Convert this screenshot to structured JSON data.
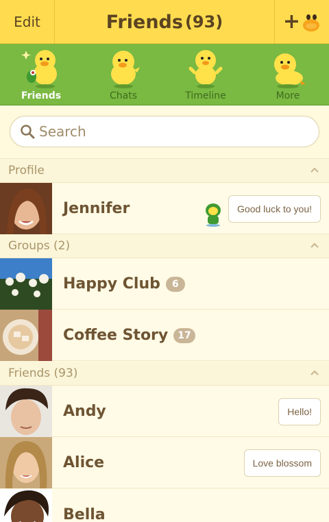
{
  "header": {
    "edit_label": "Edit",
    "title": "Friends",
    "count": "(93)",
    "add_icon": "add-friend-icon"
  },
  "tabs": [
    {
      "label": "Friends",
      "active": true
    },
    {
      "label": "Chats",
      "active": false
    },
    {
      "label": "Timeline",
      "active": false
    },
    {
      "label": "More",
      "active": false
    }
  ],
  "search": {
    "placeholder": "Search"
  },
  "sections": {
    "profile": "Profile",
    "groups": "Groups (2)",
    "friends": "Friends (93)"
  },
  "profile": {
    "name": "Jennifer",
    "status": "Good luck to you!"
  },
  "groups": [
    {
      "name": "Happy Club",
      "count": "6"
    },
    {
      "name": "Coffee Story",
      "count": "17"
    }
  ],
  "friends": [
    {
      "name": "Andy",
      "status": "Hello!"
    },
    {
      "name": "Alice",
      "status": "Love blossom"
    },
    {
      "name": "Bella"
    }
  ],
  "colors": {
    "header_bg": "#ffdc4f",
    "tab_bar_bg": "#7ab942",
    "list_bg": "#fffbe6",
    "name_text": "#6e5433"
  }
}
